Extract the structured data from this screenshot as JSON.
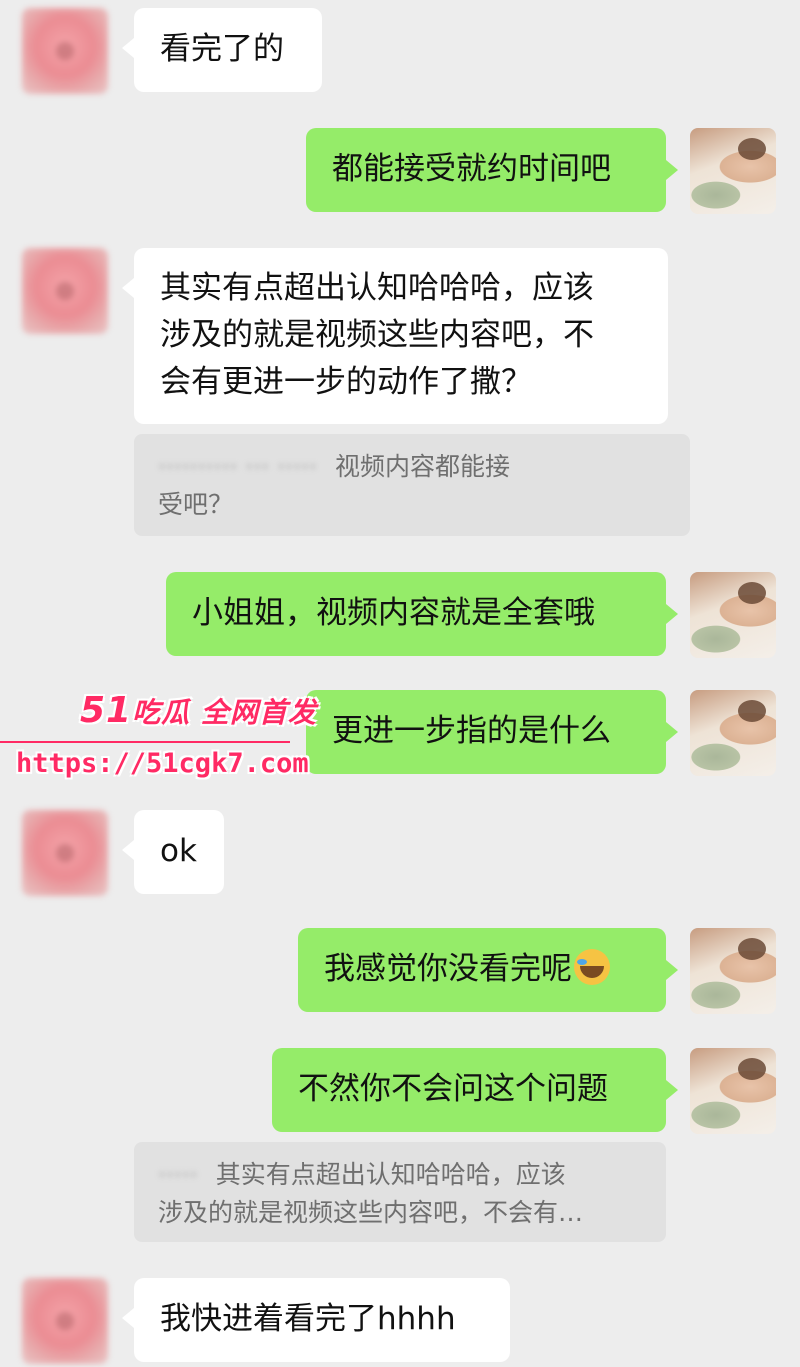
{
  "messages": [
    {
      "lines": [
        "看完了的"
      ]
    },
    {
      "lines": [
        "都能接受就约时间吧"
      ]
    },
    {
      "lines": [
        "其实有点超出认知哈哈哈，应该",
        "涉及的就是视频这些内容吧，不",
        "会有更进一步的动作了撒？"
      ]
    },
    {
      "lines": [
        "小姐姐，视频内容就是全套哦"
      ]
    },
    {
      "lines": [
        "更进一步指的是什么"
      ]
    },
    {
      "lines": [
        "ok"
      ]
    },
    {
      "lines": [
        "我感觉你没看完呢"
      ],
      "emoji": "face-with-tears-of-joy-icon"
    },
    {
      "lines": [
        "不然你不会问这个问题"
      ]
    },
    {
      "lines": [
        "我快进着看完了hhhh"
      ]
    }
  ],
  "quotes": [
    {
      "lines": [
        "视频内容都能接",
        "受吧？"
      ]
    },
    {
      "lines": [
        "其实有点超出认知哈哈哈，应该",
        "涉及的就是视频这些内容吧，不会有…"
      ]
    }
  ],
  "watermark": {
    "brand_num": "51",
    "brand_text": "吃瓜 全网首发",
    "url": "https://51cgk7.com",
    "color": "#ff2a64"
  },
  "colors": {
    "background": "#ededed",
    "incoming_bubble": "#ffffff",
    "outgoing_bubble": "#95ec69",
    "quote_bubble": "#e1e1e1"
  }
}
